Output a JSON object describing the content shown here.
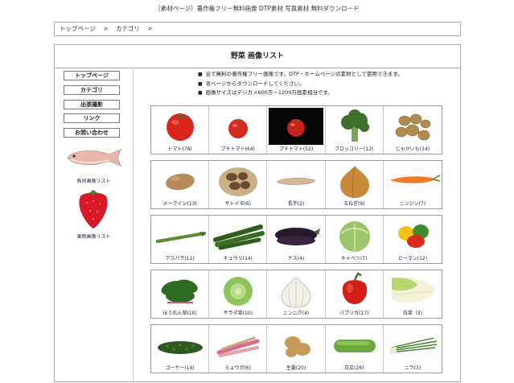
{
  "site_title": "（素材ページ）著作権フリー無料画像 DTP素材 写真素材 無料ダウンロード",
  "breadcrumb": [
    "トップページ",
    ">",
    "カテゴリ",
    ">"
  ],
  "page_title": "野菜 画像リスト",
  "nav": [
    "トップページ",
    "カテゴリ",
    "出張撮影",
    "リンク",
    "お問い合わせ"
  ],
  "side": {
    "fish": "魚貝画像リスト",
    "fruit": "果物画像リスト"
  },
  "notes": [
    "全て無料の著作権フリー画像です。DTP・ホームページの素材として使用できます。",
    "各ページからダウンロードしてください。",
    "画像サイズはデジカメ600万〜1200万画素相当です。"
  ],
  "rows": [
    [
      {
        "label": "トマト(78)",
        "icon": "tomato-icon"
      },
      {
        "label": "プチトマト(64)",
        "icon": "cherry-tomato-icon"
      },
      {
        "label": "プチトマト(52)",
        "icon": "cherry-tomato-dark-icon"
      },
      {
        "label": "ブロッコリー(12)",
        "icon": "broccoli-icon"
      },
      {
        "label": "じゃがいも(14)",
        "icon": "potato-icon"
      }
    ],
    [
      {
        "label": "メークイン(13)",
        "icon": "mayqueen-icon"
      },
      {
        "label": "サトイモ(6)",
        "icon": "taro-icon"
      },
      {
        "label": "長芋(2)",
        "icon": "yam-icon"
      },
      {
        "label": "玉ねぎ(9)",
        "icon": "onion-icon"
      },
      {
        "label": "ニンジン(7)",
        "icon": "carrot-icon"
      }
    ],
    [
      {
        "label": "アスパラ(11)",
        "icon": "asparagus-icon"
      },
      {
        "label": "キュウリ(14)",
        "icon": "cucumber-icon"
      },
      {
        "label": "ナス(4)",
        "icon": "eggplant-icon"
      },
      {
        "label": "キャベツ(7)",
        "icon": "cabbage-icon"
      },
      {
        "label": "ピーマン(12)",
        "icon": "pepper-icon"
      }
    ],
    [
      {
        "label": "ほうれん草(10)",
        "icon": "spinach-icon"
      },
      {
        "label": "サラダ菜(10)",
        "icon": "lettuce-icon"
      },
      {
        "label": "ニンニク(4)",
        "icon": "garlic-icon"
      },
      {
        "label": "パプリカ(17)",
        "icon": "paprika-icon"
      },
      {
        "label": "白菜（3)",
        "icon": "napa-cabbage-icon"
      }
    ],
    [
      {
        "label": "ゴーヤー(14)",
        "icon": "bitter-melon-icon"
      },
      {
        "label": "ミョウガ(6)",
        "icon": "myoga-icon"
      },
      {
        "label": "生姜(20)",
        "icon": "ginger-icon"
      },
      {
        "label": "白瓜(26)",
        "icon": "white-melon-icon"
      },
      {
        "label": "ニラ(3)",
        "icon": "chives-icon"
      }
    ]
  ]
}
